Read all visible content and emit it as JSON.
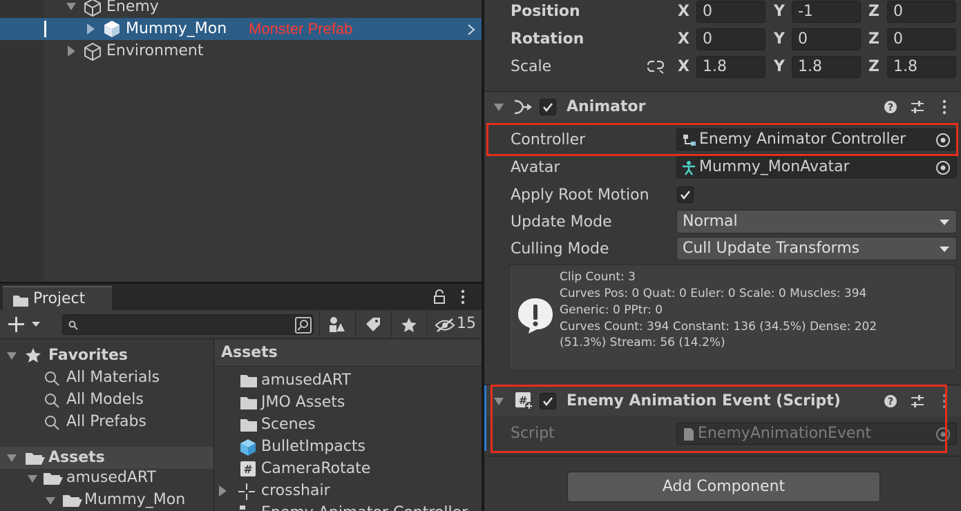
{
  "hierarchy": {
    "items": [
      {
        "label": "Enemy"
      },
      {
        "label": "Mummy_Mon",
        "annotation": "Monster Prefab"
      },
      {
        "label": "Environment"
      }
    ]
  },
  "project": {
    "tab_label": "Project",
    "search_placeholder": "",
    "hidden_count": "15",
    "favorites": {
      "label": "Favorites",
      "items": [
        "All Materials",
        "All Models",
        "All Prefabs"
      ]
    },
    "tree": {
      "root": "Assets",
      "children": [
        "amusedART",
        "Mummy_Mon"
      ]
    },
    "assets_header": "Assets",
    "assets": [
      {
        "label": "amusedART",
        "icon": "folder-icon"
      },
      {
        "label": "JMO Assets",
        "icon": "folder-icon"
      },
      {
        "label": "Scenes",
        "icon": "folder-icon"
      },
      {
        "label": "BulletImpacts",
        "icon": "prefab-icon"
      },
      {
        "label": "CameraRotate",
        "icon": "script-icon"
      },
      {
        "label": "crosshair",
        "icon": "sprite-icon"
      },
      {
        "label": "Enemy Animator Controller",
        "icon": "animator-controller-icon"
      }
    ]
  },
  "inspector": {
    "transform": {
      "position": {
        "label": "Position",
        "x": "0",
        "y": "-1",
        "z": "0"
      },
      "rotation": {
        "label": "Rotation",
        "x": "0",
        "y": "0",
        "z": "0"
      },
      "scale": {
        "label": "Scale",
        "x": "1.8",
        "y": "1.8",
        "z": "1.8"
      },
      "axis_x": "X",
      "axis_y": "Y",
      "axis_z": "Z"
    },
    "animator": {
      "title": "Animator",
      "controller_label": "Controller",
      "controller_value": "Enemy Animator Controller",
      "avatar_label": "Avatar",
      "avatar_value": "Mummy_MonAvatar",
      "apply_root_motion_label": "Apply Root Motion",
      "update_mode_label": "Update Mode",
      "update_mode_value": "Normal",
      "culling_mode_label": "Culling Mode",
      "culling_mode_value": "Cull Update Transforms",
      "info": [
        "Clip Count: 3",
        "Curves Pos: 0 Quat: 0 Euler: 0 Scale: 0 Muscles: 394",
        "Generic: 0 PPtr: 0",
        "Curves Count: 394 Constant: 136 (34.5%) Dense: 202",
        "(51.3%) Stream: 56 (14.2%)"
      ]
    },
    "script_component": {
      "title": "Enemy Animation Event (Script)",
      "script_label": "Script",
      "script_value": "EnemyAnimationEvent"
    },
    "add_component_label": "Add Component"
  },
  "colors": {
    "highlight_red": "#e62e1a",
    "selection_blue": "#2c5d87",
    "annotation_red": "#ff3b30"
  }
}
